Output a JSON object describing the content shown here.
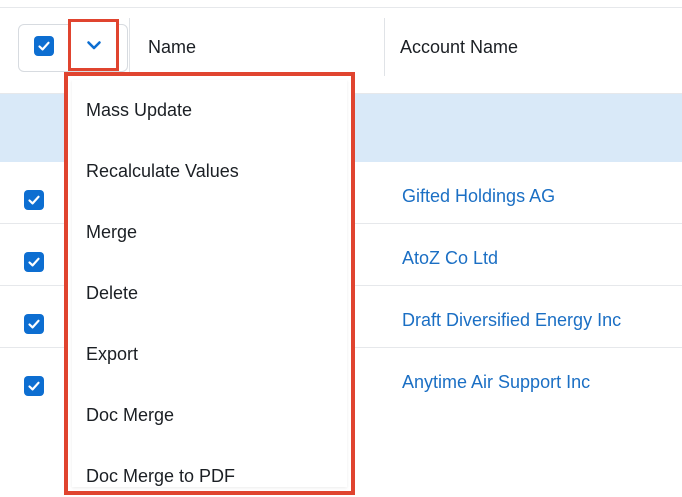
{
  "header": {
    "columns": {
      "name_label": "Name",
      "account_name_label": "Account Name"
    },
    "select_all_checked": true
  },
  "mass_actions_menu": {
    "items": [
      {
        "label": "Mass Update"
      },
      {
        "label": "Recalculate Values"
      },
      {
        "label": "Merge"
      },
      {
        "label": "Delete"
      },
      {
        "label": "Export"
      },
      {
        "label": "Doc Merge"
      },
      {
        "label": "Doc Merge to PDF"
      }
    ]
  },
  "rows": [
    {
      "checked": true,
      "account_name": "Gifted Holdings AG"
    },
    {
      "checked": true,
      "account_name": "AtoZ Co Ltd"
    },
    {
      "checked": true,
      "account_name": "Draft Diversified Energy Inc"
    },
    {
      "checked": true,
      "account_name": "Anytime Air Support Inc"
    }
  ],
  "colors": {
    "accent": "#0d6ed1",
    "link": "#1b6fc4",
    "highlight_border": "#e0442f",
    "selected_band": "#d9e9f8"
  },
  "icons": {
    "checkbox_check": "check-icon",
    "dropdown_toggle": "chevron-down-icon"
  }
}
